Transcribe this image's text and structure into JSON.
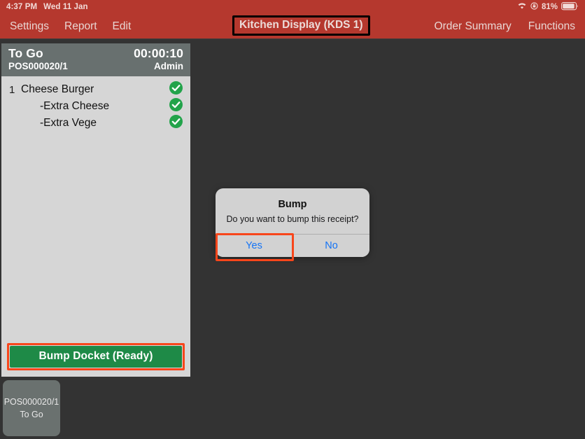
{
  "status_bar": {
    "time": "4:37 PM",
    "date": "Wed 11 Jan",
    "wifi_icon": "wifi-icon",
    "rotation_lock_icon": "rotation-lock-icon",
    "battery_percent": "81%",
    "battery_icon": "battery-icon"
  },
  "navbar": {
    "title": "Kitchen Display (KDS 1)",
    "left_items": [
      {
        "label": "Settings",
        "name": "settings"
      },
      {
        "label": "Report",
        "name": "report"
      },
      {
        "label": "Edit",
        "name": "edit"
      }
    ],
    "right_items": [
      {
        "label": "Order Summary",
        "name": "order-summary"
      },
      {
        "label": "Functions",
        "name": "functions"
      }
    ]
  },
  "docket": {
    "order_type": "To Go",
    "timer": "00:00:10",
    "reference": "POS000020/1",
    "user": "Admin",
    "lines": [
      {
        "qty": "1",
        "name": "Cheese Burger",
        "modifier": false,
        "status_icon": "check-circle-icon"
      },
      {
        "qty": "",
        "name": "-Extra Cheese",
        "modifier": true,
        "status_icon": "check-circle-icon"
      },
      {
        "qty": "",
        "name": "-Extra Vege",
        "modifier": true,
        "status_icon": "check-circle-icon"
      }
    ],
    "bump_button_label": "Bump Docket (Ready)"
  },
  "docket_tabs": [
    {
      "reference": "POS000020/1",
      "order_type": "To Go"
    }
  ],
  "alert": {
    "title": "Bump",
    "message": "Do you want to bump this receipt?",
    "confirm_label": "Yes",
    "cancel_label": "No"
  },
  "colors": {
    "nav_red": "#B5382E",
    "background_dark": "#333333",
    "docket_header_gray": "#68706F",
    "docket_body_gray": "#D6D6D6",
    "bump_green": "#1E8A47",
    "highlight_orange": "#F8461B",
    "link_blue": "#1574F5",
    "check_green": "#22A34A"
  }
}
